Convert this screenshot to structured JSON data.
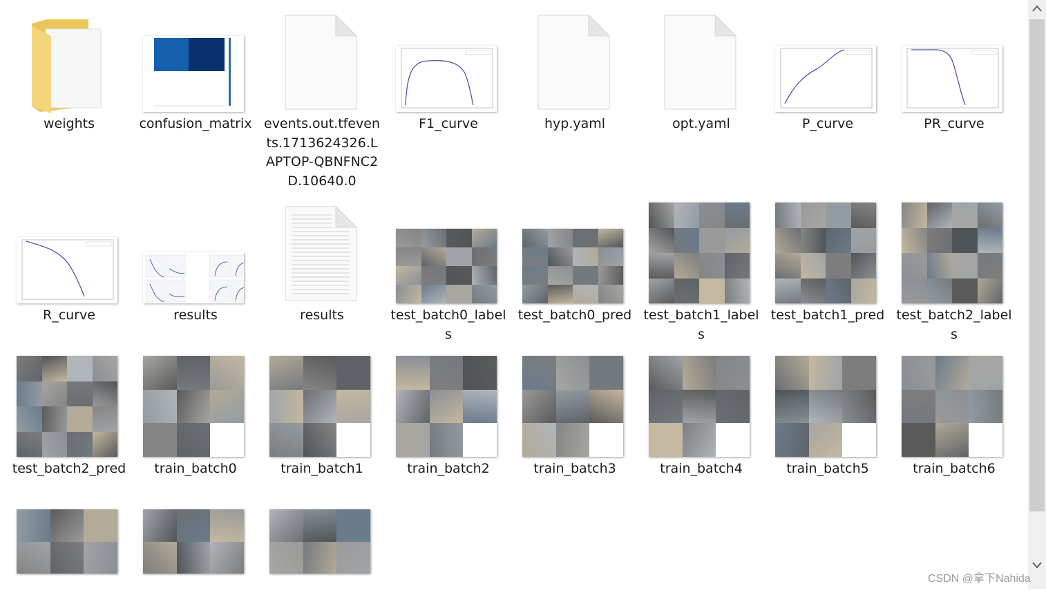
{
  "files": [
    {
      "label": "weights",
      "kind": "folder"
    },
    {
      "label": "confusion_matrix",
      "kind": "confusion"
    },
    {
      "label": "events.out.tfevents.1713624326.LAPTOP-QBNFNC2D.10640.0",
      "kind": "blank"
    },
    {
      "label": "F1_curve",
      "kind": "curve-f1"
    },
    {
      "label": "hyp.yaml",
      "kind": "blank"
    },
    {
      "label": "opt.yaml",
      "kind": "blank"
    },
    {
      "label": "P_curve",
      "kind": "curve-p"
    },
    {
      "label": "PR_curve",
      "kind": "curve-pr"
    },
    {
      "label": "R_curve",
      "kind": "curve-r"
    },
    {
      "label": "results",
      "kind": "results-plot"
    },
    {
      "label": "results",
      "kind": "text-doc"
    },
    {
      "label": "test_batch0_labels",
      "kind": "mosaic-wide"
    },
    {
      "label": "test_batch0_pred",
      "kind": "mosaic-wide"
    },
    {
      "label": "test_batch1_labels",
      "kind": "mosaic-square"
    },
    {
      "label": "test_batch1_pred",
      "kind": "mosaic-square"
    },
    {
      "label": "test_batch2_labels",
      "kind": "mosaic-square"
    },
    {
      "label": "test_batch2_pred",
      "kind": "mosaic-square"
    },
    {
      "label": "train_batch0",
      "kind": "mosaic-train"
    },
    {
      "label": "train_batch1",
      "kind": "mosaic-train"
    },
    {
      "label": "train_batch2",
      "kind": "mosaic-train"
    },
    {
      "label": "train_batch3",
      "kind": "mosaic-train"
    },
    {
      "label": "train_batch4",
      "kind": "mosaic-train"
    },
    {
      "label": "train_batch5",
      "kind": "mosaic-train"
    },
    {
      "label": "train_batch6",
      "kind": "mosaic-train"
    },
    {
      "label": "",
      "kind": "mosaic-partial"
    },
    {
      "label": "",
      "kind": "mosaic-partial"
    },
    {
      "label": "",
      "kind": "mosaic-partial"
    }
  ],
  "watermark": "CSDN @拿下Nahida",
  "icons": {
    "scroll_up": "chevron-up-icon",
    "scroll_down": "chevron-down-icon"
  }
}
